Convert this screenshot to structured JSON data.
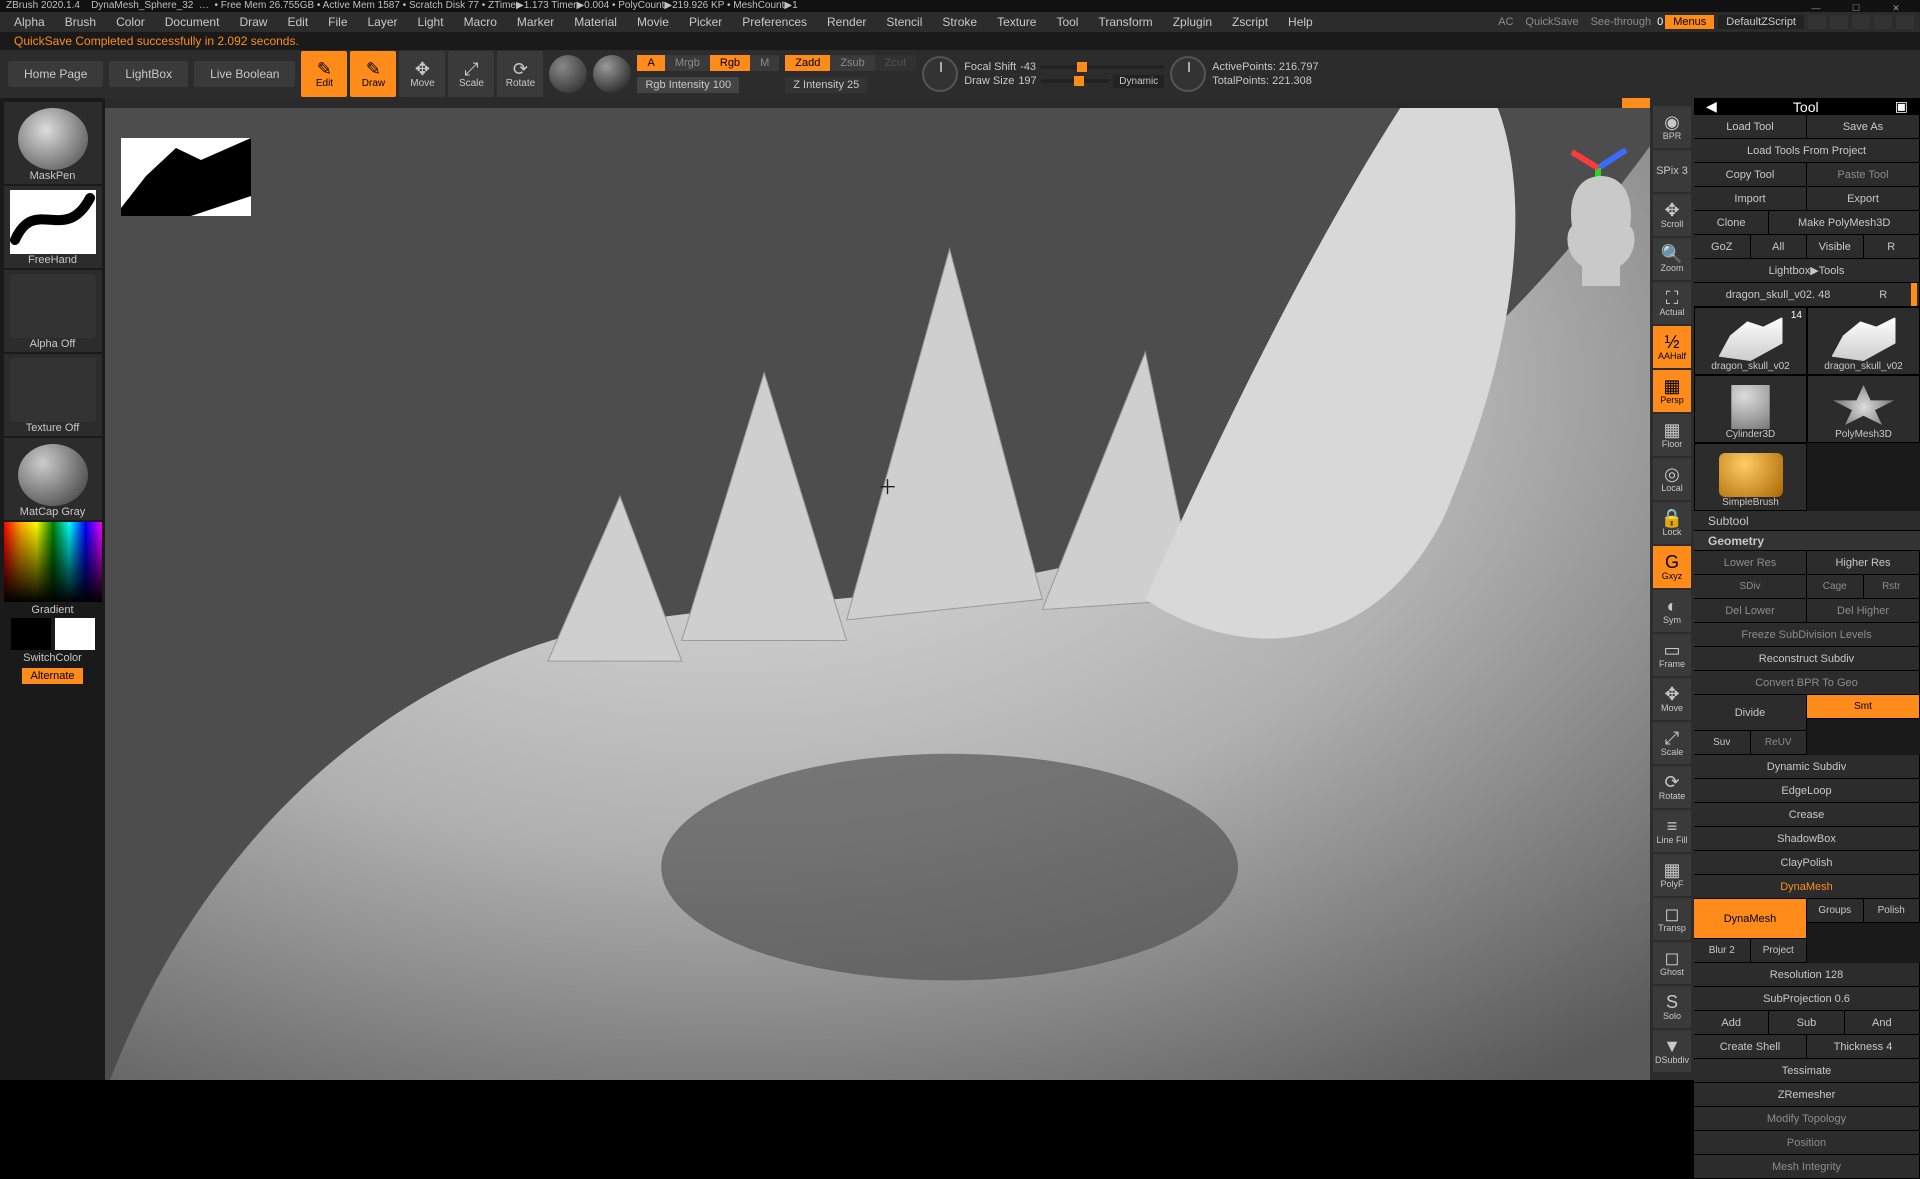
{
  "title": {
    "app": "ZBrush 2020.1.4",
    "doc": "DynaMesh_Sphere_32",
    "mem": "• Free Mem 26.755GB • Active Mem 1587 • Scratch Disk 77 • ZTime▶1.173 Timer▶0.004 • PolyCount▶219.926 KP • MeshCount▶1"
  },
  "menus": [
    "Alpha",
    "Brush",
    "Color",
    "Document",
    "Draw",
    "Edit",
    "File",
    "Layer",
    "Light",
    "Macro",
    "Marker",
    "Material",
    "Movie",
    "Picker",
    "Preferences",
    "Render",
    "Stencil",
    "Stroke",
    "Texture",
    "Tool",
    "Transform",
    "Zplugin",
    "Zscript",
    "Help"
  ],
  "menubar_right": {
    "ac": "AC",
    "quicksave": "QuickSave",
    "seethrough_label": "See-through",
    "seethrough_val": "0",
    "menus": "Menus",
    "script": "DefaultZScript"
  },
  "status": "QuickSave Completed successfully in 2.092 seconds.",
  "secbar": {
    "tabs": [
      "Home Page",
      "LightBox",
      "Live Boolean"
    ],
    "mode_btns": [
      "Edit",
      "Draw",
      "Move",
      "Scale",
      "Rotate"
    ],
    "mode_active": 0,
    "mode_also_active": 1,
    "color_row": {
      "a": "A",
      "mrgb": "Mrgb",
      "rgb": "Rgb",
      "m": "M"
    },
    "rgb_label": "Rgb Intensity",
    "rgb_val": "100",
    "z_row": {
      "zadd": "Zadd",
      "zsub": "Zsub",
      "zcut": "Zcut"
    },
    "zint_label": "Z Intensity",
    "zint_val": "25",
    "focal_label": "Focal Shift",
    "focal_val": "-43",
    "draw_label": "Draw Size",
    "draw_val": "197",
    "dynamic": "Dynamic",
    "active_pts": "ActivePoints: 216.797",
    "total_pts": "TotalPoints: 221.308"
  },
  "left": {
    "brush": "MaskPen",
    "stroke": "FreeHand",
    "alpha": "Alpha Off",
    "texture": "Texture Off",
    "material": "MatCap Gray",
    "gradient": "Gradient",
    "switch": "SwitchColor",
    "alternate": "Alternate"
  },
  "rail": {
    "items": [
      "BPR",
      "SPix 3",
      "Scroll",
      "Zoom",
      "Actual",
      "AAHalf",
      "Persp",
      "Floor",
      "Local",
      "Lock",
      "Gxyz",
      "Sym",
      "Frame",
      "Move",
      "Scale",
      "Rotate",
      "Line Fill",
      "PolyF",
      "Transp",
      "Ghost",
      "Solo",
      "DSubdiv"
    ],
    "highlight": [
      5,
      6,
      10
    ]
  },
  "right": {
    "header": "Tool",
    "row1": [
      "Load Tool",
      "Save As"
    ],
    "row2": "Load Tools From Project",
    "row3": [
      "Copy Tool",
      "Paste Tool"
    ],
    "row4": [
      "Import",
      "Export"
    ],
    "row5": [
      "Clone",
      "Make PolyMesh3D"
    ],
    "row6": [
      "GoZ",
      "All",
      "Visible",
      "R"
    ],
    "row7": "Lightbox▶Tools",
    "row8": [
      "dragon_skull_v02. 48",
      "R"
    ],
    "thumbs": [
      {
        "name": "dragon_skull_v02",
        "cls": "skull",
        "badge": "14"
      },
      {
        "name": "dragon_skull_v02",
        "cls": "skull"
      },
      {
        "name": "Cylinder3D",
        "cls": "cyl"
      },
      {
        "name": "PolyMesh3D",
        "cls": "star"
      },
      {
        "name": "SimpleBrush",
        "cls": "s"
      }
    ],
    "sections": [
      "Subtool",
      "Geometry"
    ],
    "geom": {
      "lrow": [
        "Lower Res",
        "Higher Res"
      ],
      "sdiv": "SDiv",
      "cage": "Cage",
      "rstr": "Rstr",
      "delrow": [
        "Del Lower",
        "Del Higher"
      ],
      "freeze": "Freeze SubDivision Levels",
      "recon": "Reconstruct Subdiv",
      "convert": "Convert BPR To Geo",
      "divide": "Divide",
      "smt": "Smt",
      "suv": "Suv",
      "reuv": "ReUV",
      "dyn": "Dynamic Subdiv",
      "edgeloop": "EdgeLoop",
      "crease": "Crease",
      "shadowbox": "ShadowBox",
      "clay": "ClayPolish",
      "dms": "DynaMesh",
      "dm": "DynaMesh",
      "groups": "Groups",
      "polish": "Polish",
      "blur": "Blur 2",
      "project": "Project",
      "res": "Resolution 128",
      "subproj": "SubProjection 0.6",
      "addrow": [
        "Add",
        "Sub",
        "And"
      ],
      "shell": "Create Shell",
      "thick": "Thickness 4",
      "tess": "Tessimate",
      "zrem": "ZRemesher",
      "modify": "Modify Topology",
      "position": "Position",
      "meshi": "Mesh Integrity"
    }
  }
}
